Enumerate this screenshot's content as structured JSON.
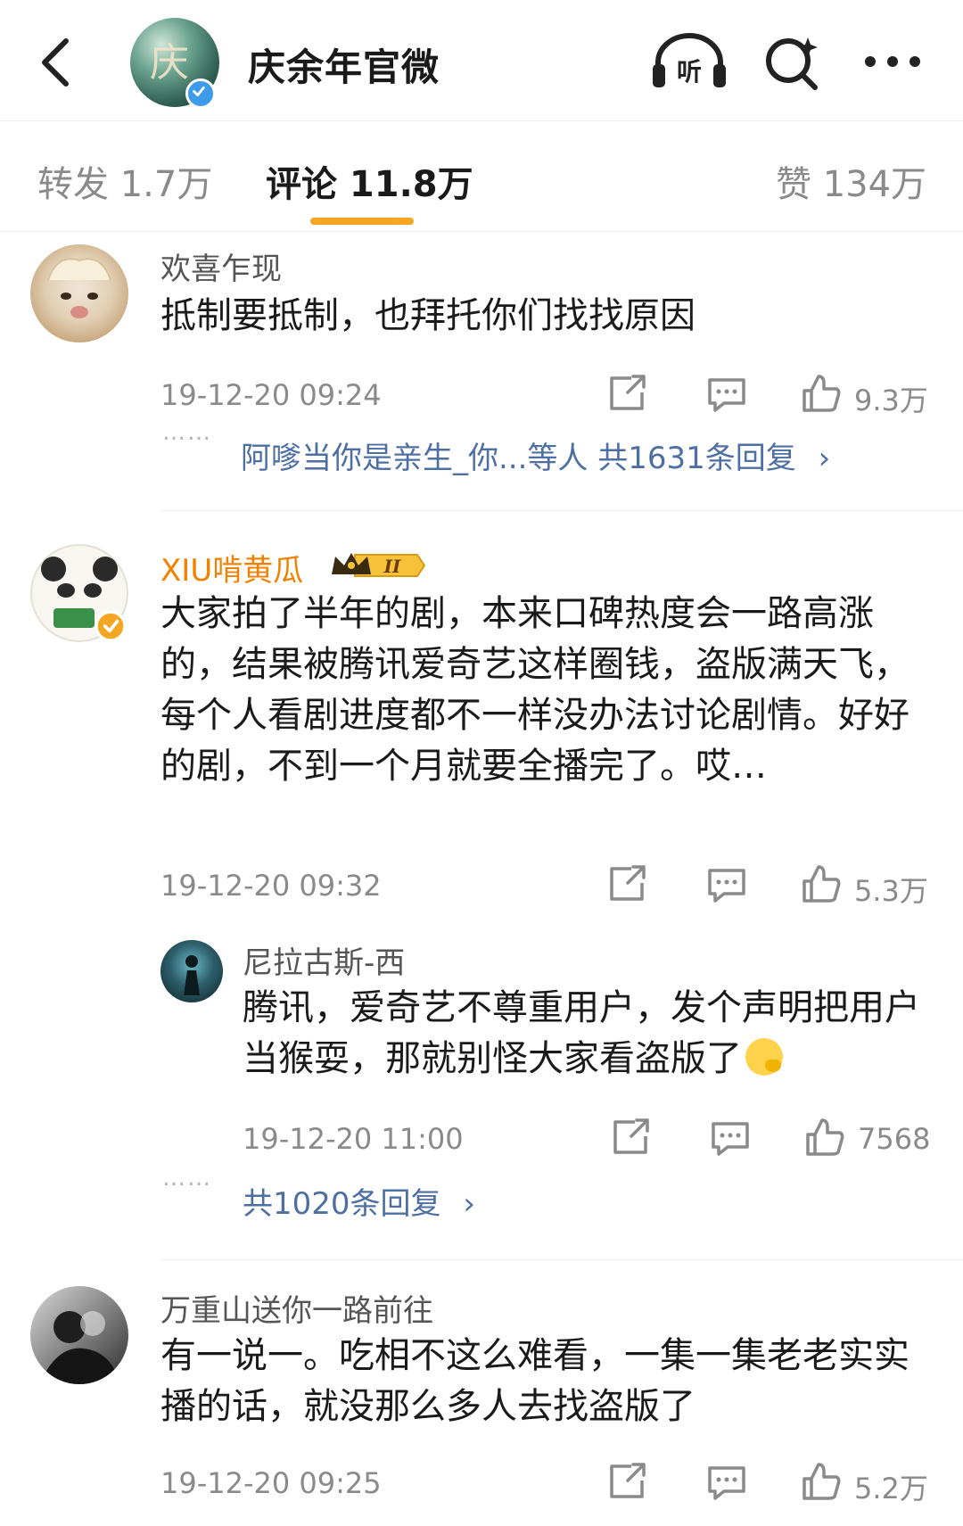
{
  "header": {
    "title": "庆余年官微",
    "icons": [
      "back-icon",
      "listen-icon",
      "search-icon",
      "more-icon"
    ],
    "listen_label": "听"
  },
  "tabs": {
    "repost": "转发 1.7万",
    "comments": "评论 11.8万",
    "likes": "赞 134万",
    "active": "comments",
    "accent_color": "#f5a623"
  },
  "comments": [
    {
      "username": "欢喜乍现",
      "content": "抵制要抵制，也拜托你们找找原因",
      "timestamp": "19-12-20 09:24",
      "likes": "9.3万",
      "reply_dots": "……",
      "reply_summary": "阿嗲当你是亲生_你...等人  共1631条回复"
    },
    {
      "username": "XIU啃黄瓜",
      "badge": "II",
      "content": "大家拍了半年的剧，本来口碑热度会一路高涨的，结果被腾讯爱奇艺这样圈钱，盗版满天飞，每个人看剧进度都不一样没办法讨论剧情。好好的剧，不到一个月就要全播完了。哎…",
      "timestamp": "19-12-20 09:32",
      "likes": "5.3万",
      "reply": {
        "username": "尼拉古斯-西",
        "content": "腾讯，爱奇艺不尊重用户，发个声明把用户当猴耍，那就别怪大家看盗版了",
        "timestamp": "19-12-20 11:00",
        "likes": "7568"
      },
      "reply_dots": "……",
      "reply_summary": "共1020条回复"
    },
    {
      "username": "万重山送你一路前往",
      "content": "有一说一。吃相不这么难看，一集一集老老实实播的话，就没那么多人去找盗版了",
      "timestamp": "19-12-20 09:25",
      "likes": "5.2万"
    }
  ],
  "colors": {
    "vip_name": "#f08200",
    "link": "#4e6fa3",
    "muted": "#8a8a8a",
    "verify": "#3d9bea"
  }
}
